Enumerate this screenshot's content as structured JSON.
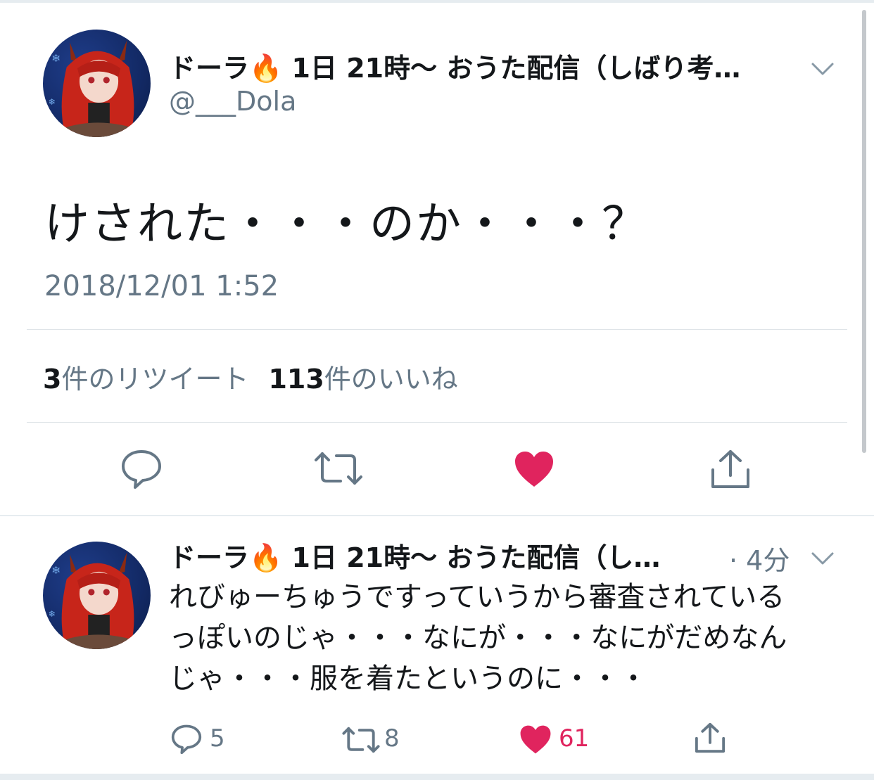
{
  "main_tweet": {
    "display_name": "ドーラ🔥 1日 21時〜 おうた配信（しばり考…",
    "handle": "@___Dola",
    "text": "けされた・・・のか・・・？",
    "timestamp": "2018/12/01 1:52",
    "stats": {
      "retweet_count": "3",
      "retweet_label": "件のリツイート",
      "like_count": "113",
      "like_label": "件のいいね"
    },
    "actions": [
      "reply-icon",
      "retweet-icon",
      "like-icon",
      "share-icon"
    ]
  },
  "reply_tweet": {
    "display_name": "ドーラ🔥 1日 21時〜 おうた配信（し…",
    "time": "· 4分",
    "text_lines": [
      "れびゅーちゅうですっていうから審査されている",
      "っぽいのじゃ・・・なにが・・・なにがだめなん",
      "じゃ・・・服を着たというのに・・・"
    ],
    "reply_count": "5",
    "retweet_count": "8",
    "like_count": "61"
  },
  "colors": {
    "text": "#14171a",
    "secondary": "#657786",
    "like": "#e0245e",
    "divider": "#e6ecf0"
  }
}
